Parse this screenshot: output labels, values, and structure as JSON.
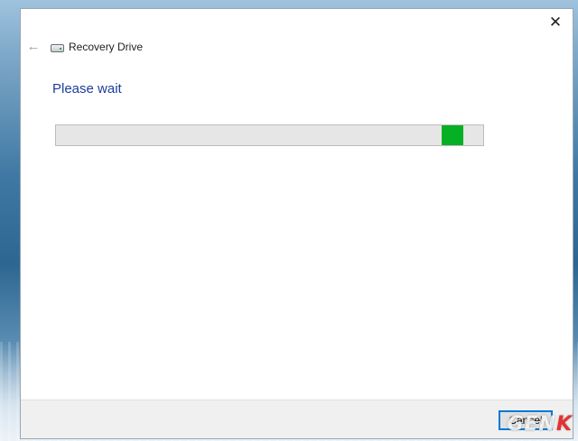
{
  "window": {
    "title": "Recovery Drive",
    "back_icon": "arrow-left-icon",
    "app_icon": "drive-icon",
    "close_icon": "close-icon",
    "close_glyph": "✕",
    "back_glyph": "←"
  },
  "main": {
    "heading": "Please wait",
    "progress": {
      "indeterminate": true,
      "position_fraction": 0.95,
      "segment_fraction": 0.05,
      "fill_color": "#06b025"
    }
  },
  "footer": {
    "cancel_label": "Cancel"
  },
  "watermark": {
    "text_main": "GEN",
    "text_accent": "K"
  },
  "colors": {
    "heading": "#1e3d9a",
    "accent": "#0078d7"
  }
}
